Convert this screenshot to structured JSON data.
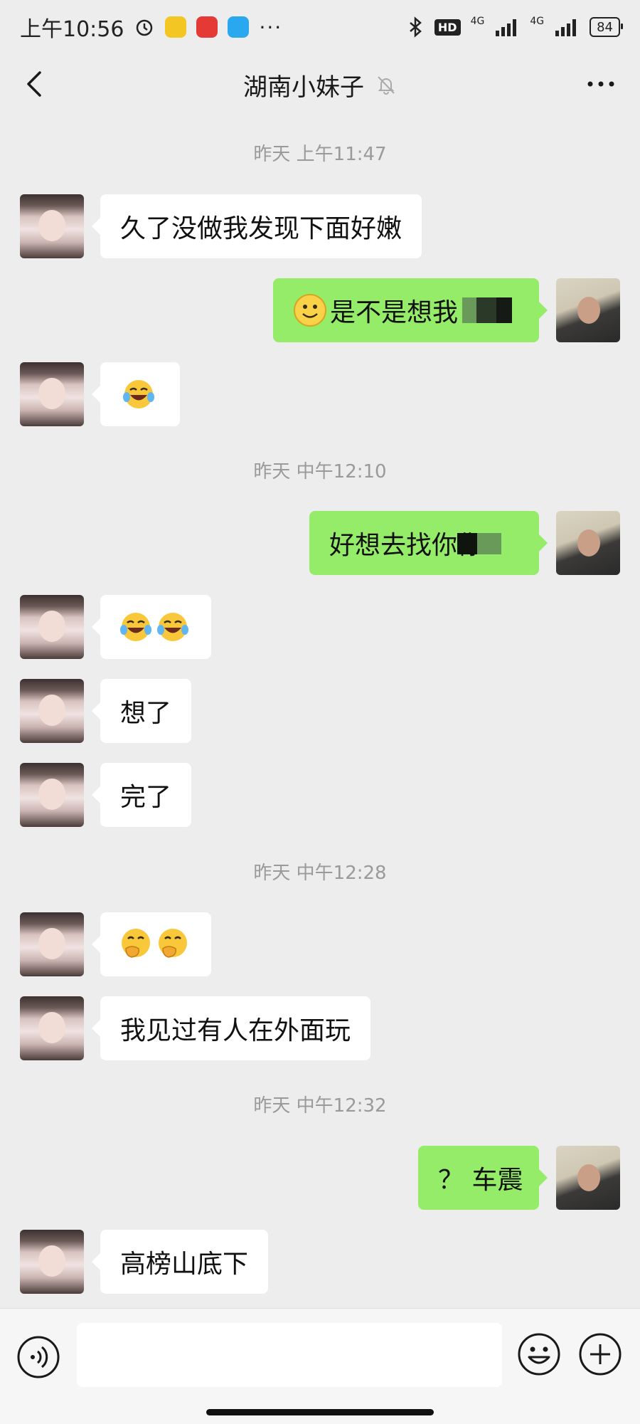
{
  "status_bar": {
    "time": "上午10:56",
    "network_1": "4G",
    "network_2": "4G",
    "hd": "HD",
    "battery": "84",
    "more": "···"
  },
  "nav": {
    "title": "湖南小妹子"
  },
  "messages": [
    {
      "type": "time",
      "text": "昨天 上午11:47"
    },
    {
      "type": "text",
      "side": "left",
      "text": "久了没做我发现下面好嫩"
    },
    {
      "type": "text",
      "side": "right",
      "text": "是不是想我",
      "emoji": "smiley",
      "redacted": true
    },
    {
      "type": "emoji",
      "side": "left",
      "emojis": [
        "laugh-cry"
      ]
    },
    {
      "type": "time",
      "text": "昨天 中午12:10"
    },
    {
      "type": "text",
      "side": "right",
      "text": "好想去找你你",
      "redacted": true
    },
    {
      "type": "emoji",
      "side": "left",
      "emojis": [
        "laugh-cry",
        "laugh-cry"
      ]
    },
    {
      "type": "text",
      "side": "left",
      "text": "想了"
    },
    {
      "type": "text",
      "side": "left",
      "text": "完了"
    },
    {
      "type": "time",
      "text": "昨天 中午12:28"
    },
    {
      "type": "emoji",
      "side": "left",
      "emojis": [
        "hand-over-mouth",
        "hand-over-mouth"
      ]
    },
    {
      "type": "text",
      "side": "left",
      "text": "我见过有人在外面玩"
    },
    {
      "type": "time",
      "text": "昨天 中午12:32"
    },
    {
      "type": "text",
      "side": "right",
      "text": "？ 车震"
    },
    {
      "type": "text",
      "side": "left",
      "text": "高榜山底下"
    }
  ],
  "input": {
    "value": "",
    "placeholder": ""
  },
  "icons": {
    "back": "chevron-left-icon",
    "mute": "bell-off-icon",
    "more": "more-horizontal-icon",
    "voice": "voice-icon",
    "emoji": "emoji-face-icon",
    "plus": "plus-circle-icon"
  },
  "colors": {
    "background": "#ededed",
    "bubble_left": "#ffffff",
    "bubble_right": "#95ec69",
    "timestamp": "#9a9a9a"
  }
}
